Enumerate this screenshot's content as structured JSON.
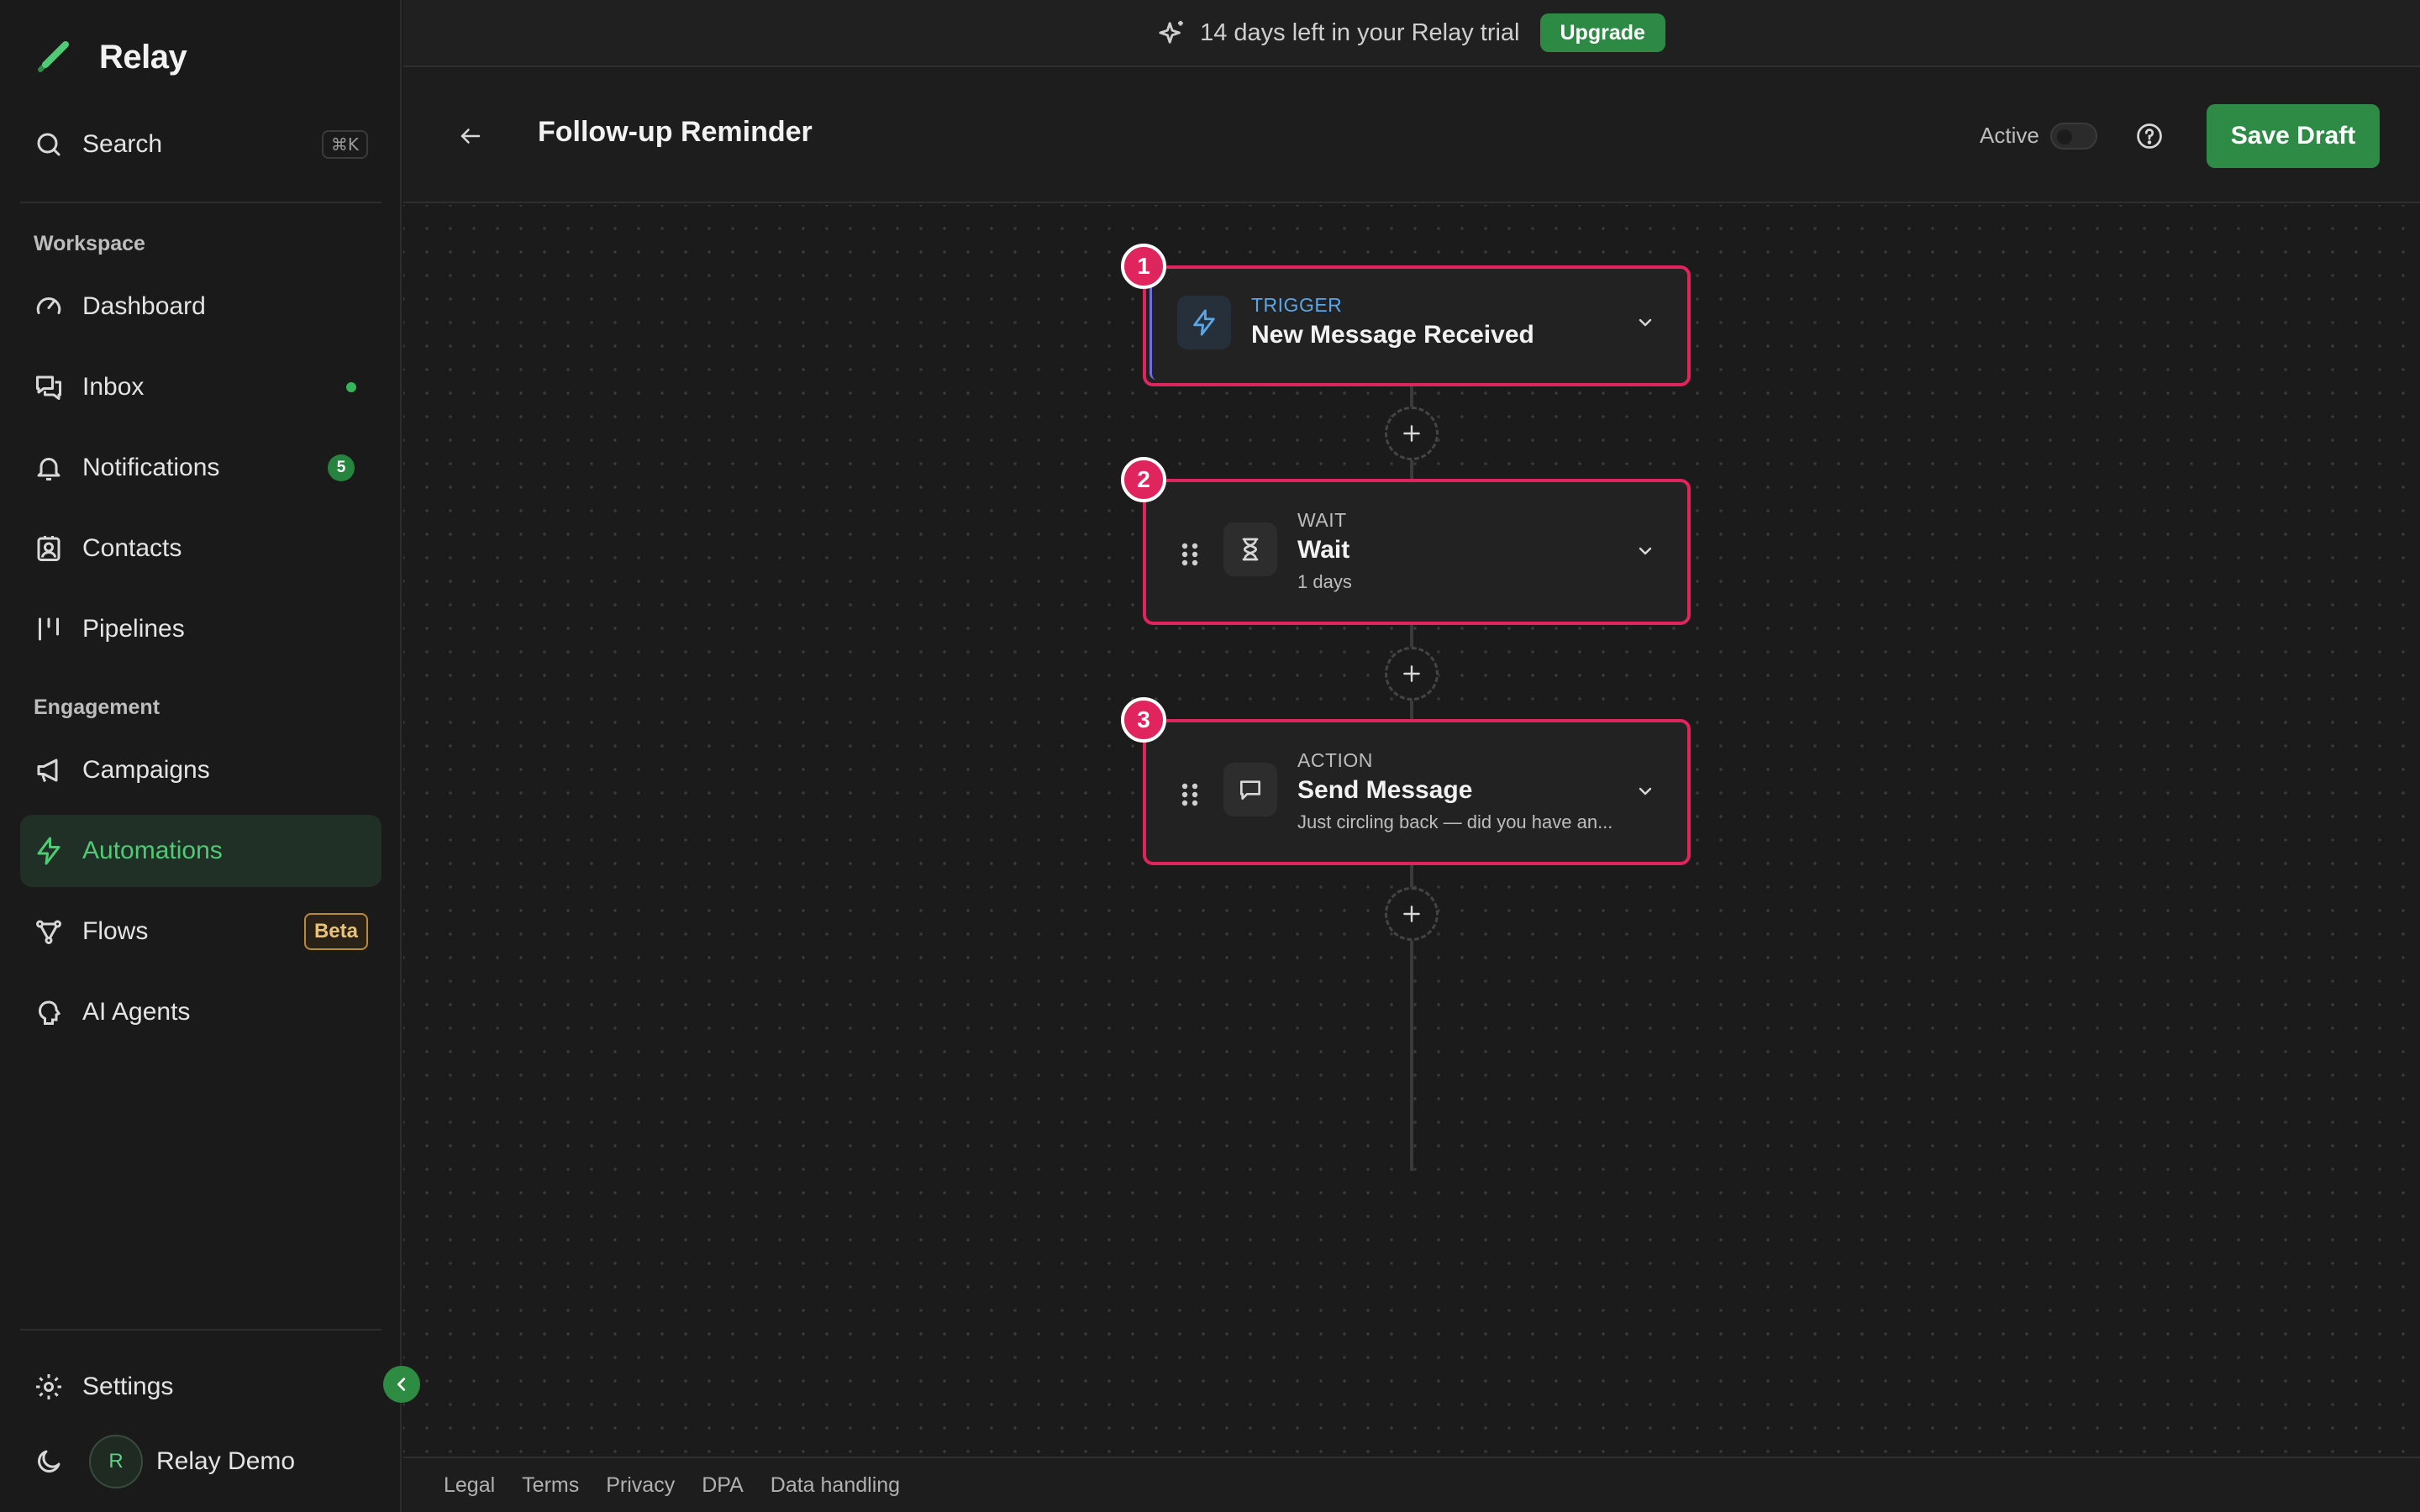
{
  "app": {
    "name": "Relay",
    "accent": "#2e8b45",
    "highlight": "#e0245e"
  },
  "sidebar": {
    "search": {
      "label": "Search",
      "shortcut": "⌘K"
    },
    "sections": {
      "workspace": "Workspace",
      "engagement": "Engagement"
    },
    "items": [
      {
        "label": "Dashboard",
        "icon": "gauge-icon"
      },
      {
        "label": "Inbox",
        "icon": "chat-icon",
        "indicator": "dot"
      },
      {
        "label": "Notifications",
        "icon": "bell-icon",
        "count": "5"
      },
      {
        "label": "Contacts",
        "icon": "contact-icon"
      },
      {
        "label": "Pipelines",
        "icon": "pipeline-icon"
      },
      {
        "label": "Campaigns",
        "icon": "megaphone-icon"
      },
      {
        "label": "Automations",
        "icon": "bolt-icon",
        "active": true
      },
      {
        "label": "Flows",
        "icon": "flow-icon",
        "badge": "Beta"
      },
      {
        "label": "AI Agents",
        "icon": "agent-icon"
      }
    ],
    "settings": "Settings",
    "user": {
      "initial": "R",
      "name": "Relay Demo"
    }
  },
  "banner": {
    "text": "14 days left in your Relay trial",
    "button": "Upgrade"
  },
  "header": {
    "title": "Follow-up Reminder",
    "active_label": "Active",
    "active": false,
    "save_label": "Save Draft"
  },
  "workflow": {
    "steps": [
      {
        "number": "1",
        "type": "TRIGGER",
        "title": "New Message Received",
        "subtitle": "",
        "icon": "bolt-icon"
      },
      {
        "number": "2",
        "type": "WAIT",
        "title": "Wait",
        "subtitle": "1 days",
        "icon": "hourglass-icon"
      },
      {
        "number": "3",
        "type": "ACTION",
        "title": "Send Message",
        "subtitle": "Just circling back — did you have an...",
        "icon": "message-icon"
      }
    ]
  },
  "footer": {
    "links": [
      "Legal",
      "Terms",
      "Privacy",
      "DPA",
      "Data handling"
    ]
  }
}
